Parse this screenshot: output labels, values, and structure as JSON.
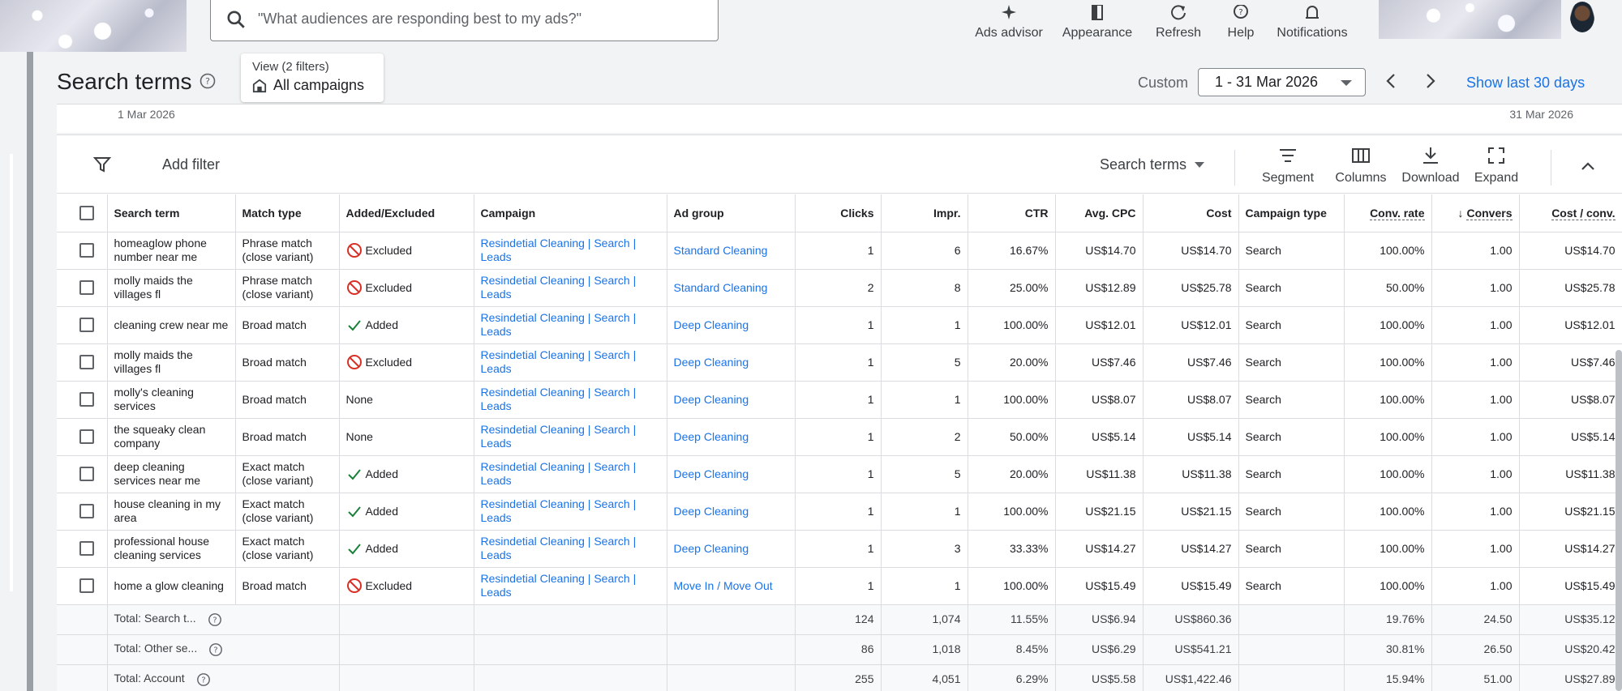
{
  "topbar": {
    "search_placeholder": "\"What audiences are responding best to my ads?\"",
    "tools": [
      {
        "label": "Ads advisor",
        "icon": "sparkle-icon"
      },
      {
        "label": "Appearance",
        "icon": "appearance-icon"
      },
      {
        "label": "Refresh",
        "icon": "refresh-icon"
      },
      {
        "label": "Help",
        "icon": "help-icon"
      },
      {
        "label": "Notifications",
        "icon": "bell-icon"
      }
    ]
  },
  "header": {
    "title": "Search terms",
    "view_sub": "View (2 filters)",
    "view_main": "All campaigns",
    "date_label": "Custom",
    "date_range": "1 - 31 Mar 2026",
    "show_last": "Show last 30 days",
    "axis_start": "1 Mar 2026",
    "axis_end": "31 Mar 2026"
  },
  "filterbar": {
    "add_filter": "Add filter",
    "search_terms_select": "Search terms",
    "segment": "Segment",
    "columns": "Columns",
    "download": "Download",
    "expand": "Expand"
  },
  "table": {
    "columns": [
      "Search term",
      "Match type",
      "Added/Excluded",
      "Campaign",
      "Ad group",
      "Clicks",
      "Impr.",
      "CTR",
      "Avg. CPC",
      "Cost",
      "Campaign type",
      "Conv. rate",
      "Convers",
      "Cost / conv."
    ],
    "rows": [
      {
        "term": "homeaglow phone number near me",
        "match": "Phrase match (close variant)",
        "status": "Excluded",
        "campaign": "Resindetial Cleaning | Search | Leads",
        "adgroup": "Standard Cleaning",
        "clicks": "1",
        "impr": "6",
        "ctr": "16.67%",
        "cpc": "US$14.70",
        "cost": "US$14.70",
        "ctype": "Search",
        "convrate": "100.00%",
        "conv": "1.00",
        "costconv": "US$14.70"
      },
      {
        "term": "molly maids the villages fl",
        "match": "Phrase match (close variant)",
        "status": "Excluded",
        "campaign": "Resindetial Cleaning | Search | Leads",
        "adgroup": "Standard Cleaning",
        "clicks": "2",
        "impr": "8",
        "ctr": "25.00%",
        "cpc": "US$12.89",
        "cost": "US$25.78",
        "ctype": "Search",
        "convrate": "50.00%",
        "conv": "1.00",
        "costconv": "US$25.78"
      },
      {
        "term": "cleaning crew near me",
        "match": "Broad match",
        "status": "Added",
        "campaign": "Resindetial Cleaning | Search | Leads",
        "adgroup": "Deep Cleaning",
        "clicks": "1",
        "impr": "1",
        "ctr": "100.00%",
        "cpc": "US$12.01",
        "cost": "US$12.01",
        "ctype": "Search",
        "convrate": "100.00%",
        "conv": "1.00",
        "costconv": "US$12.01"
      },
      {
        "term": "molly maids the villages fl",
        "match": "Broad match",
        "status": "Excluded",
        "campaign": "Resindetial Cleaning | Search | Leads",
        "adgroup": "Deep Cleaning",
        "clicks": "1",
        "impr": "5",
        "ctr": "20.00%",
        "cpc": "US$7.46",
        "cost": "US$7.46",
        "ctype": "Search",
        "convrate": "100.00%",
        "conv": "1.00",
        "costconv": "US$7.46"
      },
      {
        "term": "molly's cleaning services",
        "match": "Broad match",
        "status": "None",
        "campaign": "Resindetial Cleaning | Search | Leads",
        "adgroup": "Deep Cleaning",
        "clicks": "1",
        "impr": "1",
        "ctr": "100.00%",
        "cpc": "US$8.07",
        "cost": "US$8.07",
        "ctype": "Search",
        "convrate": "100.00%",
        "conv": "1.00",
        "costconv": "US$8.07"
      },
      {
        "term": "the squeaky clean company",
        "match": "Broad match",
        "status": "None",
        "campaign": "Resindetial Cleaning | Search | Leads",
        "adgroup": "Deep Cleaning",
        "clicks": "1",
        "impr": "2",
        "ctr": "50.00%",
        "cpc": "US$5.14",
        "cost": "US$5.14",
        "ctype": "Search",
        "convrate": "100.00%",
        "conv": "1.00",
        "costconv": "US$5.14"
      },
      {
        "term": "deep cleaning services near me",
        "match": "Exact match (close variant)",
        "status": "Added",
        "campaign": "Resindetial Cleaning | Search | Leads",
        "adgroup": "Deep Cleaning",
        "clicks": "1",
        "impr": "5",
        "ctr": "20.00%",
        "cpc": "US$11.38",
        "cost": "US$11.38",
        "ctype": "Search",
        "convrate": "100.00%",
        "conv": "1.00",
        "costconv": "US$11.38"
      },
      {
        "term": "house cleaning in my area",
        "match": "Exact match (close variant)",
        "status": "Added",
        "campaign": "Resindetial Cleaning | Search | Leads",
        "adgroup": "Deep Cleaning",
        "clicks": "1",
        "impr": "1",
        "ctr": "100.00%",
        "cpc": "US$21.15",
        "cost": "US$21.15",
        "ctype": "Search",
        "convrate": "100.00%",
        "conv": "1.00",
        "costconv": "US$21.15"
      },
      {
        "term": "professional house cleaning services",
        "match": "Exact match (close variant)",
        "status": "Added",
        "campaign": "Resindetial Cleaning | Search | Leads",
        "adgroup": "Deep Cleaning",
        "clicks": "1",
        "impr": "3",
        "ctr": "33.33%",
        "cpc": "US$14.27",
        "cost": "US$14.27",
        "ctype": "Search",
        "convrate": "100.00%",
        "conv": "1.00",
        "costconv": "US$14.27"
      },
      {
        "term": "home a glow cleaning",
        "match": "Broad match",
        "status": "Excluded",
        "campaign": "Resindetial Cleaning | Search | Leads",
        "adgroup": "Move In / Move Out",
        "clicks": "1",
        "impr": "1",
        "ctr": "100.00%",
        "cpc": "US$15.49",
        "cost": "US$15.49",
        "ctype": "Search",
        "convrate": "100.00%",
        "conv": "1.00",
        "costconv": "US$15.49"
      }
    ],
    "totals": [
      {
        "label": "Total: Search t...",
        "clicks": "124",
        "impr": "1,074",
        "ctr": "11.55%",
        "cpc": "US$6.94",
        "cost": "US$860.36",
        "convrate": "19.76%",
        "conv": "24.50",
        "costconv": "US$35.12"
      },
      {
        "label": "Total: Other se...",
        "clicks": "86",
        "impr": "1,018",
        "ctr": "8.45%",
        "cpc": "US$6.29",
        "cost": "US$541.21",
        "convrate": "30.81%",
        "conv": "26.50",
        "costconv": "US$20.42"
      },
      {
        "label": "Total: Account",
        "clicks": "255",
        "impr": "4,051",
        "ctr": "6.29%",
        "cpc": "US$5.58",
        "cost": "US$1,422.46",
        "convrate": "15.94%",
        "conv": "51.00",
        "costconv": "US$27.89"
      }
    ]
  },
  "colors": {
    "link": "#1a73e8",
    "excluded": "#d93025",
    "added": "#188038"
  }
}
